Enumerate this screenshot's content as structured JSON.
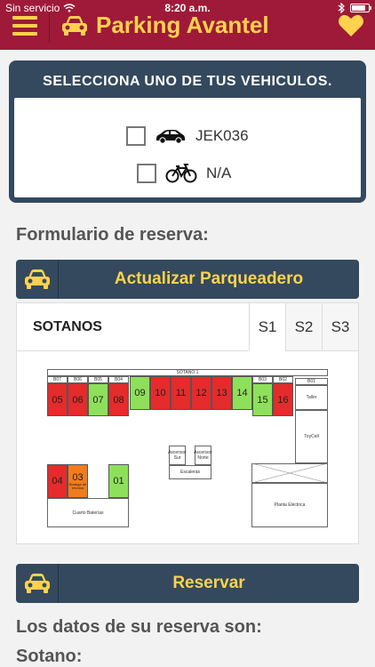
{
  "status": {
    "carrier": "Sin servicio",
    "time": "8:20 a.m."
  },
  "header": {
    "title": "Parking Avantel"
  },
  "vehicles": {
    "heading": "SELECCIONA UNO DE TUS VEHICULOS.",
    "items": [
      {
        "label": "JEK036",
        "icon": "car-icon"
      },
      {
        "label": "N/A",
        "icon": "bicycle-icon"
      }
    ]
  },
  "form": {
    "label": "Formulario de reserva:",
    "update_button": "Actualizar Parqueadero",
    "reserve_button": "Reservar",
    "summary_label": "Los datos de su reserva son:",
    "sotano_label": "Sotano:"
  },
  "map": {
    "title": "SOTANOS",
    "tabs": [
      "S1",
      "S2",
      "S3"
    ],
    "active_tab": "S1",
    "header_label": "SOTANO 1",
    "spots_top": [
      {
        "id": "05",
        "header": "B07",
        "status": "red"
      },
      {
        "id": "06",
        "header": "B06",
        "status": "red"
      },
      {
        "id": "07",
        "header": "B05",
        "status": "green"
      },
      {
        "id": "08",
        "header": "B04",
        "status": "red"
      },
      {
        "id": "09",
        "header": "",
        "status": "green"
      },
      {
        "id": "10",
        "header": "",
        "status": "red"
      },
      {
        "id": "11",
        "header": "",
        "status": "red"
      },
      {
        "id": "12",
        "header": "",
        "status": "red"
      },
      {
        "id": "13",
        "header": "",
        "status": "red"
      },
      {
        "id": "14",
        "header": "",
        "status": "green"
      },
      {
        "id": "15",
        "header": "B03",
        "status": "green"
      },
      {
        "id": "16",
        "header": "B02",
        "status": "red"
      }
    ],
    "spots_bottom": [
      {
        "id": "04",
        "status": "red"
      },
      {
        "id": "03",
        "status": "orange",
        "sub": "Bodega de técnica"
      },
      {
        "id": "01",
        "status": "green"
      }
    ],
    "labels": {
      "b01": "B01",
      "taller": "Taller",
      "toycell": "ToyCell",
      "asc_sur": "Ascensor Sur",
      "asc_norte": "Ascensor Norte",
      "escaleras": "Escaleras",
      "cuarto": "Cuarto Baterías",
      "planta": "Planta Eléctrica"
    }
  },
  "colors": {
    "brand": "#9e1a38",
    "accent": "#ffd24d",
    "panel": "#34495e",
    "occupied": "#e52b2b",
    "free": "#8ee05a",
    "reserved": "#f07c1d"
  }
}
